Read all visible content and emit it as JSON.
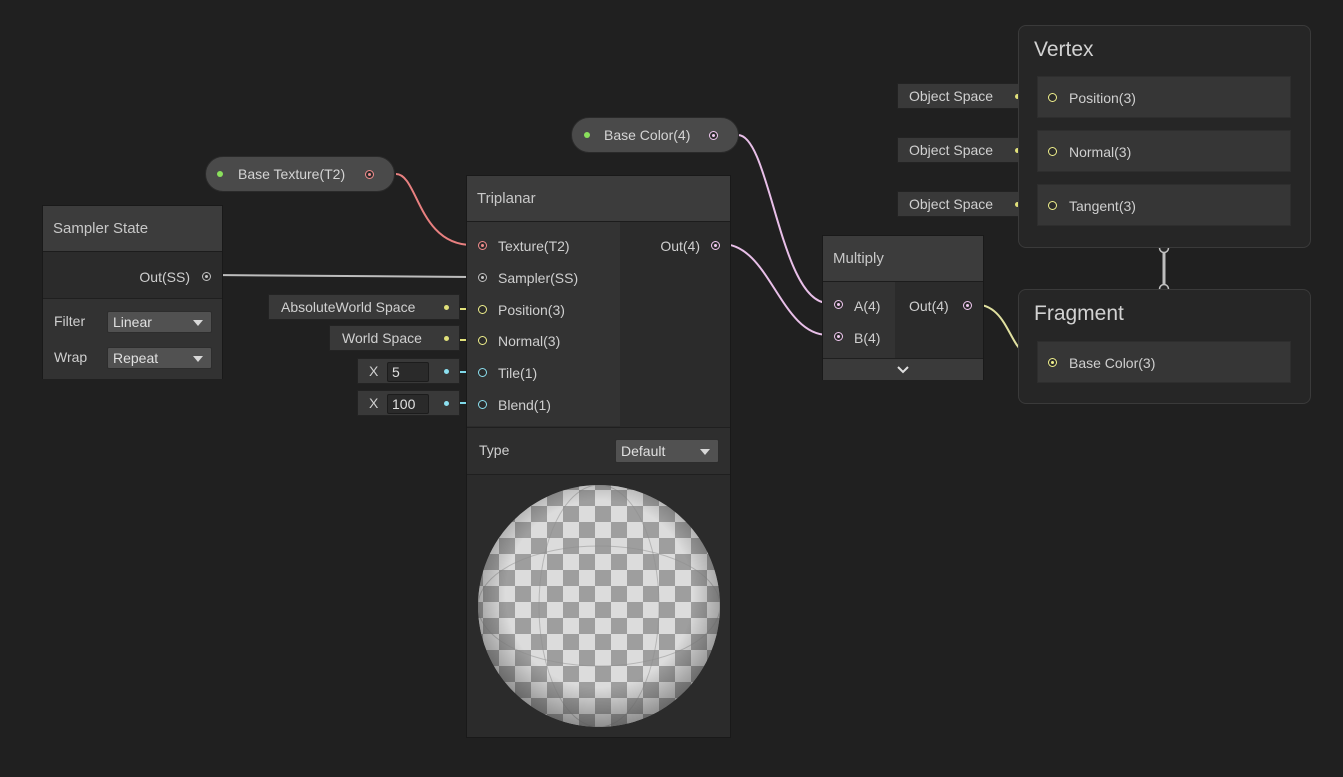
{
  "nodes": {
    "sampler_state": {
      "title": "Sampler State",
      "output": "Out(SS)",
      "filter_label": "Filter",
      "filter_value": "Linear",
      "wrap_label": "Wrap",
      "wrap_value": "Repeat"
    },
    "base_texture": {
      "label": "Base Texture(T2)"
    },
    "base_color": {
      "label": "Base Color(4)"
    },
    "triplanar": {
      "title": "Triplanar",
      "inputs": [
        "Texture(T2)",
        "Sampler(SS)",
        "Position(3)",
        "Normal(3)",
        "Tile(1)",
        "Blend(1)"
      ],
      "output": "Out(4)",
      "type_label": "Type",
      "type_value": "Default",
      "preview_icon": "checker-sphere-preview"
    },
    "multiply": {
      "title": "Multiply",
      "inputs": [
        "A(4)",
        "B(4)"
      ],
      "output": "Out(4)",
      "expand_icon": "chevron-down-icon"
    },
    "vertex": {
      "title": "Vertex",
      "slots": [
        "Position(3)",
        "Normal(3)",
        "Tangent(3)"
      ]
    },
    "fragment": {
      "title": "Fragment",
      "slots": [
        "Base Color(3)"
      ]
    }
  },
  "inline_inputs": {
    "position_space": "AbsoluteWorld Space",
    "normal_space": "World Space",
    "tile": {
      "axis": "X",
      "value": "5"
    },
    "blend": {
      "axis": "X",
      "value": "100"
    },
    "vertex_position_space": "Object Space",
    "vertex_normal_space": "Object Space",
    "vertex_tangent_space": "Object Space"
  },
  "colors": {
    "background": "#202020",
    "texture_port": "#f08c8c",
    "vector4_port": "#f0c8f0",
    "vector3_port": "#f0f08c",
    "float_port": "#8ce0f0",
    "sampler_port": "#c8c8c8",
    "property_dot": "#8ae05c"
  }
}
